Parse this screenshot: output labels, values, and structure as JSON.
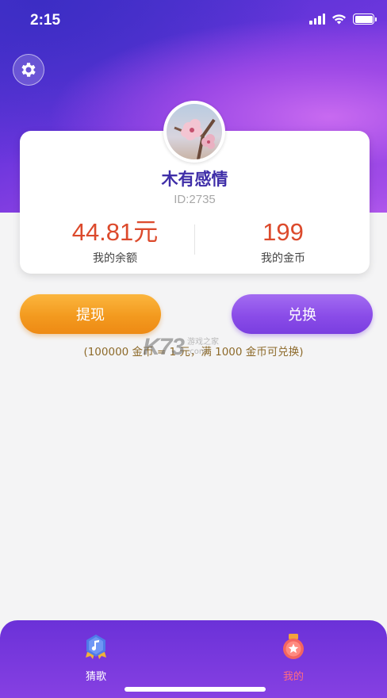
{
  "status_bar": {
    "time": "2:15"
  },
  "profile": {
    "nickname": "木有感情",
    "id_text": "ID:2735"
  },
  "stats": {
    "balance_value": "44.81元",
    "balance_label": "我的余额",
    "coins_value": "199",
    "coins_label": "我的金币"
  },
  "actions": {
    "withdraw_label": "提现",
    "exchange_label": "兑换",
    "exchange_note": "(100000 金币 = 1 元，满 1000 金币可兑换)"
  },
  "watermark": {
    "logo": "K73",
    "line1": "游戏之家",
    "line2": ".com"
  },
  "tabbar": {
    "tabs": [
      {
        "label": "猜歌",
        "icon": "music-badge-icon",
        "active": false
      },
      {
        "label": "我的",
        "icon": "medal-icon",
        "active": true
      }
    ]
  },
  "colors": {
    "header_purple": "#7a3ee0",
    "accent_red": "#dc4a2c",
    "withdraw_orange": "#f39a1f",
    "exchange_purple": "#8a4ce8",
    "active_tab": "#ff6d80"
  }
}
